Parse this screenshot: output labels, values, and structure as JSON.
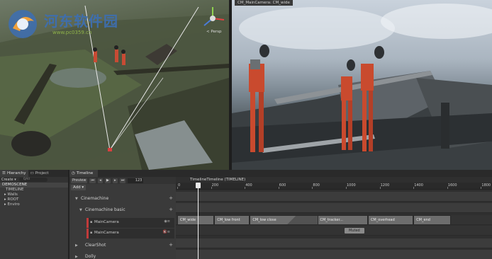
{
  "colors": {
    "accent_red": "#c03a3a",
    "track_bg": "#3c3c3c",
    "clip_bg": "#6d6d6d",
    "watermark_blue": "#3d6fb3",
    "watermark_green": "#8fb34a"
  },
  "watermark": {
    "title": "河东软件园",
    "url": "www.pc0359.cn"
  },
  "scene_view": {
    "projection_label": "< Persp"
  },
  "game_view": {
    "tab_label": "CM_MainCamera: CM_wide"
  },
  "hierarchy": {
    "tabs": [
      {
        "label": "Hierarchy",
        "icon": "list-icon"
      },
      {
        "label": "Project",
        "icon": "folder-icon"
      }
    ],
    "create_label": "Create ▾",
    "search_placeholder": "QAll",
    "items": [
      {
        "label": "DEMOSCENE",
        "kind": "scene-root"
      },
      {
        "label": "TIMELINE",
        "kind": "object"
      },
      {
        "label": "▸ Walls",
        "kind": "object"
      },
      {
        "label": "▸ ROOT",
        "kind": "object"
      },
      {
        "label": "▸ Enviro",
        "kind": "object"
      }
    ]
  },
  "timeline": {
    "tab_label": "Timeline",
    "preview_label": "Preview",
    "frame_value": "123",
    "add_label": "Add ▾",
    "title": "TimelineTimeline (TIMELINE)",
    "ruler_labels": [
      "0",
      "200",
      "400",
      "600",
      "800",
      "1000",
      "1200",
      "1400",
      "1600",
      "1800"
    ],
    "playhead_frame": 123,
    "tracks": [
      {
        "label": "Cinemachine",
        "type": "group"
      },
      {
        "label": "Cinemachine basic",
        "type": "subgroup"
      },
      {
        "label": "MainCamera",
        "type": "camera"
      },
      {
        "label": "MainCamera",
        "type": "camera"
      },
      {
        "label": "ClearShot",
        "type": "group"
      },
      {
        "label": "Dolly",
        "type": "group"
      }
    ],
    "clips": [
      {
        "label": "CM_wide",
        "start": 0,
        "end": 220
      },
      {
        "label": "CM_low front",
        "start": 220,
        "end": 430
      },
      {
        "label": "CM_low close",
        "start": 430,
        "end": 930,
        "blend_from": 680
      },
      {
        "label": "CM_tracker...",
        "start": 830,
        "end": 1130
      },
      {
        "label": "CM_overhead",
        "start": 1130,
        "end": 1400
      },
      {
        "label": "CM_end",
        "start": 1400,
        "end": 1620
      }
    ],
    "muted_label": "Muted"
  }
}
